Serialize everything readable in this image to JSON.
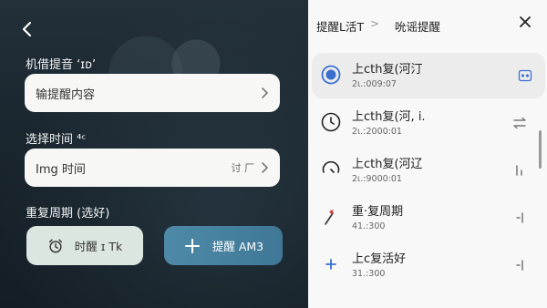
{
  "left": {
    "section1_label": "机借提音 ‘ɪᴅ’",
    "input_placeholder": "输提醒内容",
    "section2_label": "选择时间 ⁴ᶜ",
    "time_field_value": "Img 时间",
    "time_field_hint": "讨 厂",
    "section3_label": "重复周期 (选好)",
    "button_alarm_label": "时醒 ɪ Tk",
    "button_add_label": "提醒 AM3"
  },
  "right": {
    "header_title": "提醒L活T",
    "header_sep": ">",
    "header_subtitle": "吮谣提醒",
    "items": [
      {
        "title": "上cth复(河汀",
        "subtitle": "2ι.:009:07"
      },
      {
        "title": "上cth复(河, i.",
        "subtitle": "2ι.:2000:01"
      },
      {
        "title": "上cth复(河辽",
        "subtitle": "2ι.:9000:01"
      },
      {
        "title": "重·复周期",
        "subtitle": "41.:300"
      },
      {
        "title": "上c复活好",
        "subtitle": "31.:300"
      }
    ]
  },
  "colors": {
    "accent_blue": "#3a6fd0",
    "add_button": "#4784a3",
    "alarm_button": "#dce6e0",
    "flag_red": "#d43b3b"
  },
  "icons": [
    "back-arrow-icon",
    "chevron-right-icon",
    "alarm-clock-icon",
    "plus-icon",
    "close-icon",
    "radio-selected-icon",
    "clock-icon",
    "half-clock-icon",
    "flag-icon",
    "plus-small-icon",
    "calendar-icon",
    "swap-icon",
    "slider-icon"
  ]
}
